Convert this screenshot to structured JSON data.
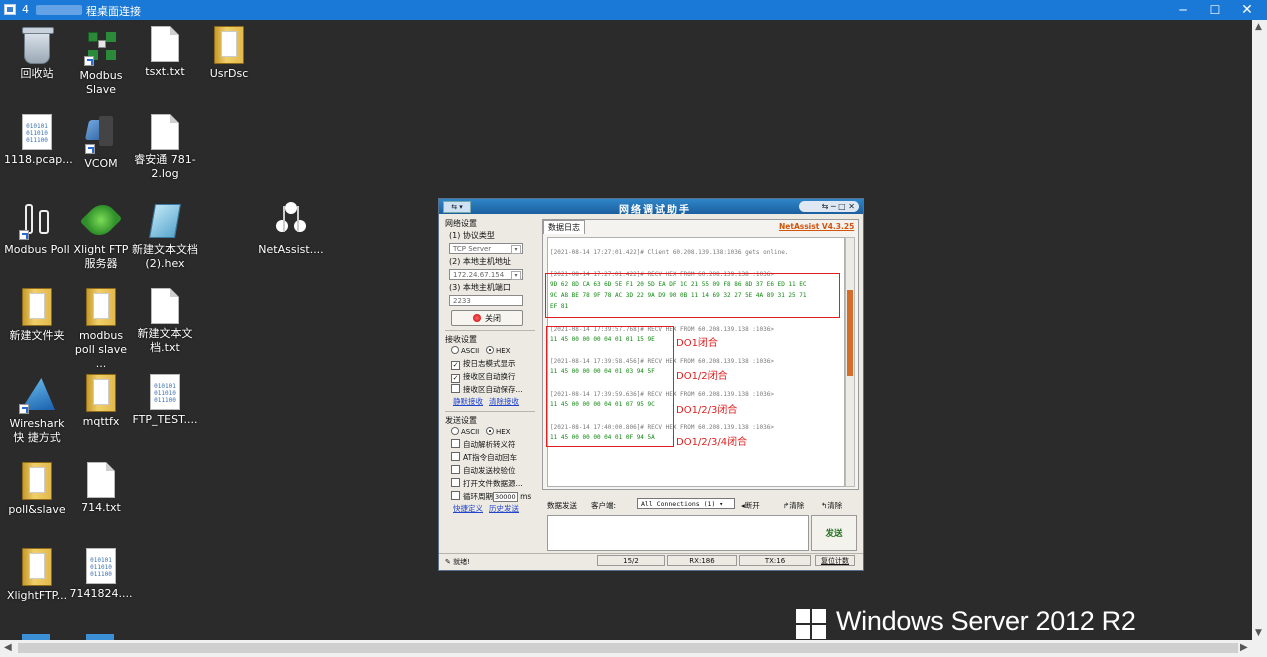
{
  "remote_desktop": {
    "title": "4",
    "title_suffix": "程桌面连接",
    "controls": {
      "minimize": "─",
      "maximize": "☐",
      "close": "✕"
    }
  },
  "desktop_icons": [
    {
      "label": "回收站",
      "icon": "recycle-bin-icon"
    },
    {
      "label": "Modbus Slave",
      "icon": "modbus-slave-icon"
    },
    {
      "label": "tsxt.txt",
      "icon": "text-file-icon"
    },
    {
      "label": "UsrDsc",
      "icon": "folder-icon"
    },
    {
      "label": "1118.pcap...",
      "icon": "binary-file-icon"
    },
    {
      "label": "VCOM",
      "icon": "vcom-icon"
    },
    {
      "label": "睿安通 781-2.log",
      "icon": "text-file-icon"
    },
    {
      "label": "Modbus Poll",
      "icon": "modbus-poll-icon"
    },
    {
      "label": "Xlight FTP 服务器",
      "icon": "xlight-ftp-icon"
    },
    {
      "label": "新建文本文档 (2).hex",
      "icon": "notepad-icon"
    },
    {
      "label": "NetAssist....",
      "icon": "netassist-icon"
    },
    {
      "label": "新建文件夹",
      "icon": "folder-icon"
    },
    {
      "label": "modbus poll slave ...",
      "icon": "folder-icon"
    },
    {
      "label": "新建文本文 档.txt",
      "icon": "text-file-icon"
    },
    {
      "label": "Wireshark 快 捷方式",
      "icon": "wireshark-icon"
    },
    {
      "label": "mqttfx",
      "icon": "folder-icon"
    },
    {
      "label": "FTP_TEST....",
      "icon": "binary-file-icon"
    },
    {
      "label": "poll&slave",
      "icon": "folder-icon"
    },
    {
      "label": "714.txt",
      "icon": "text-file-icon"
    },
    {
      "label": "XlightFTP...",
      "icon": "folder-icon"
    },
    {
      "label": "7141824....",
      "icon": "binary-file-icon"
    }
  ],
  "binary_glyph_text": [
    "010101",
    "011010",
    "011100"
  ],
  "brand": {
    "text": "Windows Server 2012 R2"
  },
  "netassist": {
    "title": "网络调试助手",
    "sys_menu": "⇆ ▾",
    "win_controls": "⇆ ─ □ ✕",
    "network_settings": "网络设置",
    "protocol_label": "(1) 协议类型",
    "protocol_value": "TCP Server",
    "local_ip_label": "(2) 本地主机地址",
    "local_ip_value": "172.24.67.154",
    "local_port_label": "(3) 本地主机端口",
    "local_port_value": "2233",
    "close_button": "关闭",
    "recv_settings": "接收设置",
    "recv_ascii": "ASCII",
    "recv_hex": "HEX",
    "recv_opt1": "按日志模式显示",
    "recv_opt2": "接收区自动换行",
    "recv_opt3": "接收区自动保存...",
    "recv_link1": "静默接收",
    "recv_link2": "清除接收",
    "send_settings": "发送设置",
    "send_ascii": "ASCII",
    "send_hex": "HEX",
    "send_opt1": "自动解析转义符",
    "send_opt2": "AT指令自动回车",
    "send_opt3": "自动发送校验位",
    "send_opt4": "打开文件数据源...",
    "send_opt5": "循环周期",
    "cycle_value": "30000",
    "cycle_unit": "ms",
    "send_link1": "快捷定义",
    "send_link2": "历史发送",
    "log_tab": "数据日志",
    "version": "NetAssist V4.3.25",
    "log_lines": [
      "[2021-08-14 17:27:01.422]# Client 60.208.139.138:1036 gets online.",
      "[2021-08-14 17:27:01.422]# RECV HEX FROM 60.208.139.138 :1036>",
      "9D 62 8D CA 63 6D 5E F1 20 5D EA DF 1C 21 55 09 F8 86 8D 37 E6 ED 11 EC",
      "9C A8 BE 78 9F 78 AC 3D 22 9A D9 90 0B 11 14 69 32 27 5E 4A 89 31 25 71",
      "EF 81",
      "[2021-08-14 17:39:57.768]# RECV HEX FROM 60.208.139.138 :1036>",
      "11 45 00 00 00 04 01 01 15 9E",
      "[2021-08-14 17:39:58.456]# RECV HEX FROM 60.208.139.138 :1036>",
      "11 45 00 00 00 04 01 03 94 5F",
      "[2021-08-14 17:39:59.636]# RECV HEX FROM 60.208.139.138 :1036>",
      "11 45 00 00 00 04 01 07 95 9C",
      "[2021-08-14 17:40:00.806]# RECV HEX FROM 60.208.139.138 :1036>",
      "11 45 00 00 00 04 01 0F 94 5A"
    ],
    "annotations": [
      "DO1闭合",
      "DO1/2闭合",
      "DO1/2/3闭合",
      "DO1/2/3/4闭合"
    ],
    "send_tab": "数据发送",
    "client_label": "客户端:",
    "connections_value": "All Connections (1)",
    "disconnect_button": "断开",
    "clear1_button": "清除",
    "clear2_button": "清除",
    "send_button": "发送",
    "status_ready": "就绪!",
    "status_count": "15/2",
    "status_rx": "RX:186",
    "status_tx": "TX:16",
    "reset_count": "复位计数"
  }
}
